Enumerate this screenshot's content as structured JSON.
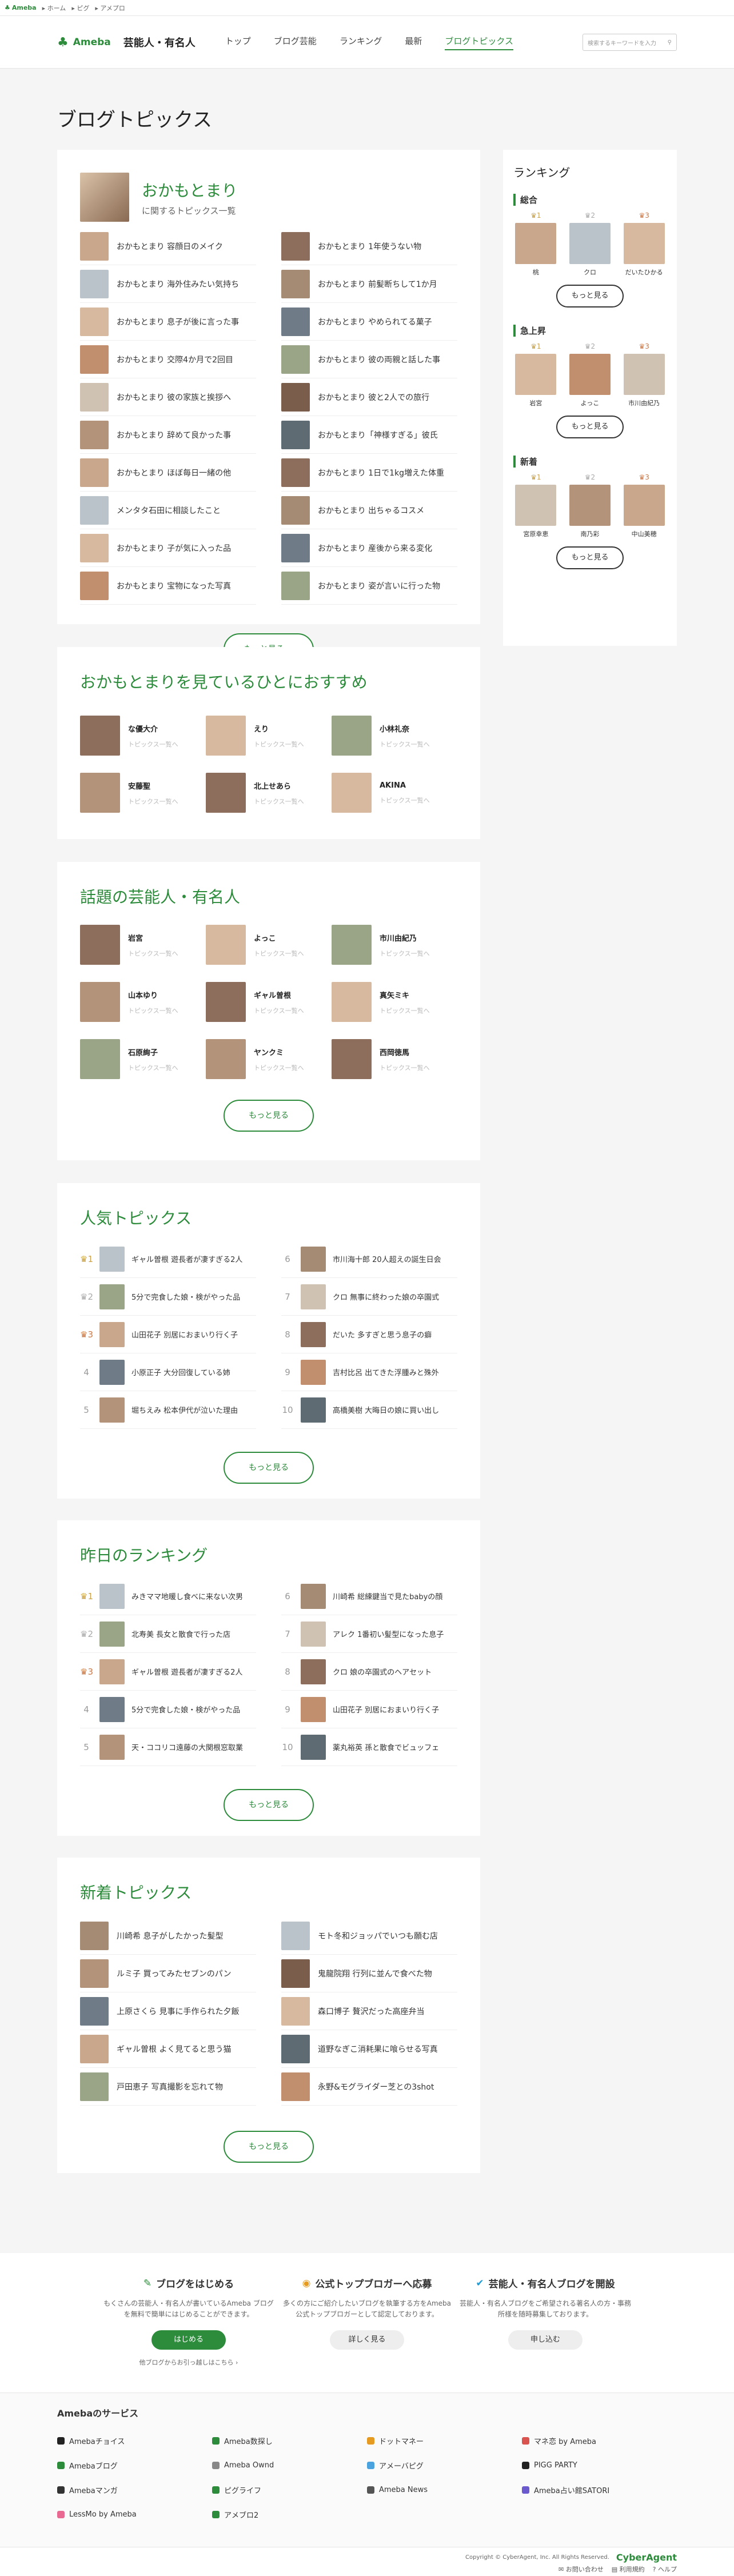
{
  "topbar": {
    "logo": "Ameba",
    "links": [
      "ホーム",
      "ピグ",
      "アメプロ"
    ]
  },
  "header": {
    "logo": "Ameba",
    "title": "芸能人・有名人",
    "nav": [
      "トップ",
      "ブログ芸能",
      "ランキング",
      "最新",
      "ブログトピックス"
    ],
    "search_placeholder": "検索するキーワードを入力"
  },
  "page_title": "ブログトピックス",
  "profile": {
    "name": "おかもとまり",
    "sub": "に関するトピックス一覧"
  },
  "topics": [
    "おかもとまり 容顔日のメイク",
    "おかもとまり 1年使うない物",
    "おかもとまり 海外住みたい気持ち",
    "おかもとまり 前髪断ちして1か月",
    "おかもとまり 息子が後に言った事",
    "おかもとまり やめられてる菓子",
    "おかもとまり 交際4か月で2回目",
    "おかもとまり 彼の両親と話した事",
    "おかもとまり 彼の家族と挨拶へ",
    "おかもとまり 彼と2人での旅行",
    "おかもとまり 辞めて良かった事",
    "おかもとまり「神様すぎる」彼氏",
    "おかもとまり ほぼ毎日一緒の他",
    "おかもとまり 1日で1kg増えた体重",
    "メンタタ石田に相談したこと",
    "おかもとまり 出ちゃるコスメ",
    "おかもとまり 子が気に入った品",
    "おかもとまり 産後から来る変化",
    "おかもとまり 宝物になった写真",
    "おかもとまり 姿が言いに行った物"
  ],
  "more_label": "もっと見る",
  "recommend": {
    "title": "おかもとまりを見ているひとにおすすめ",
    "people": [
      "な優大介",
      "えり",
      "小林礼奈",
      "安藤聖",
      "北上せあら",
      "AKINA"
    ],
    "sub": "トピックス一覧へ"
  },
  "popular_people": {
    "title": "話題の芸能人・有名人",
    "people": [
      "岩宮",
      "よっこ",
      "市川由紀乃",
      "山本ゆり",
      "ギャル曽根",
      "真矢ミキ",
      "石原絢子",
      "ヤンクミ",
      "西岡徳馬"
    ],
    "sub": "トピックス一覧へ"
  },
  "popular_topics": {
    "title": "人気トピックス",
    "items": [
      "ギャル曽根 遊長者が凄すぎる2人",
      "5分で完食した娘・検がやった品",
      "山田花子 別居におまいり行く子",
      "小原正子 大分回復している姉",
      "堀ちえみ 松本伊代が泣いた理由",
      "市川海十郎 20人超えの誕生日会",
      "クロ 無事に終わった娘の卒園式",
      "だいた 多すぎと思う息子の癖",
      "吉村比呂 出てきた浮腫みと殊外",
      "高橋美樹 大晦日の娘に買い出し"
    ]
  },
  "yesterday": {
    "title": "昨日のランキング",
    "items": [
      "みきママ地暖し食べに来ない次男",
      "北寿美 長女と散食で行った店",
      "ギャル曽根 遊長者が凄すぎる2人",
      "5分で完食した娘・検がやった品",
      "天・ココリコ遠藤の大関根窓取業",
      "川崎希 総練鍵当で見たbabyの顔",
      "アレク 1番初い髪型になった息子",
      "クロ 娘の卒園式のヘアセット",
      "山田花子 別居におまいり行く子",
      "薬丸裕英 孫と散食でビュッフェ"
    ]
  },
  "new_topics": {
    "title": "新着トピックス",
    "items": [
      "川崎希 息子がしたかった髪型",
      "ルミ子 買ってみたセブンのパン",
      "上原さくら 見事に手作られた夕飯",
      "ギャル曽根 よく見てると思う猫",
      "戸田恵子 写真撮影を忘れて物",
      "モト冬和ジョッパでいつも願む店",
      "鬼龍院翔 行列に並んで食べた物",
      "森口博子 贅沢だった高座弁当",
      "道野なぎこ消耗果に喰らせる写真",
      "永野&モグライダー芝との3shot"
    ]
  },
  "ranking": {
    "title": "ランキング",
    "groups": [
      {
        "label": "総合",
        "people": [
          "桃",
          "クロ",
          "だいたひかる"
        ]
      },
      {
        "label": "急上昇",
        "people": [
          "岩宮",
          "よっこ",
          "市川由紀乃"
        ]
      },
      {
        "label": "新着",
        "people": [
          "宮原幸恵",
          "南乃彩",
          "中山美穂"
        ]
      }
    ],
    "crowns": [
      "1",
      "2",
      "3"
    ],
    "more": "もっと見る"
  },
  "cta": [
    {
      "title": "ブログをはじめる",
      "desc": "もくさんの芸能人・有名人が書いているAmeba ブログを無料で簡単にはじめることができます。",
      "btn": "はじめる",
      "link": "他ブログからお引っ越しはこちら"
    },
    {
      "title": "公式トップブロガーへ応募",
      "desc": "多くの方にご紹介したいブログを執筆する方をAmeba公式トップブロガーとして認定しております。",
      "btn": "詳しく見る"
    },
    {
      "title": "芸能人・有名人ブログを開設",
      "desc": "芸能人・有名人ブログをご希望される著名人の方・事務所様を随時募集しております。",
      "btn": "申し込む"
    }
  ],
  "services": {
    "title": "Amebaのサービス",
    "items": [
      "Amebaチョイス",
      "Ameba数探し",
      "ドットマネー",
      "マネ恋 by Ameba",
      "Amebaブログ",
      "Ameba Ownd",
      "アメーバピグ",
      "PIGG PARTY",
      "Amebaマンガ",
      "ピグライフ",
      "Ameba News",
      "Ameba占い館SATORI",
      "LessMo by Ameba",
      "アメブロ2"
    ]
  },
  "footer": {
    "copyright": "Copyright © CyberAgent, Inc. All Rights Reserved.",
    "brand": "CyberAgent",
    "links": [
      "お問い合わせ",
      "利用規約",
      "ヘルプ"
    ]
  },
  "colors": {
    "accent": "#2d8c3c"
  }
}
